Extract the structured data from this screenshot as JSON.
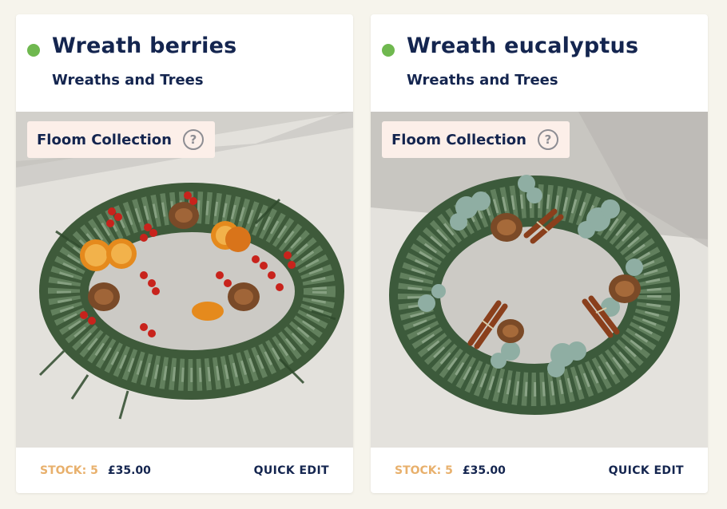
{
  "colors": {
    "page_bg": "#f6f4ec",
    "title": "#14254f",
    "status_active": "#6fb84f",
    "stock": "#e8b06c",
    "collection_tag_bg": "#fcefe9"
  },
  "products": [
    {
      "title": "Wreath berries",
      "category": "Wreaths and Trees",
      "collection_label": "Floom Collection",
      "help_icon": "?",
      "stock_label": "STOCK: 5",
      "price": "£35.00",
      "quick_edit_label": "QUICK EDIT",
      "image_icon": "wreath-berries-photo"
    },
    {
      "title": "Wreath eucalyptus",
      "category": "Wreaths and Trees",
      "collection_label": "Floom Collection",
      "help_icon": "?",
      "stock_label": "STOCK: 5",
      "price": "£35.00",
      "quick_edit_label": "QUICK EDIT",
      "image_icon": "wreath-eucalyptus-photo"
    }
  ]
}
